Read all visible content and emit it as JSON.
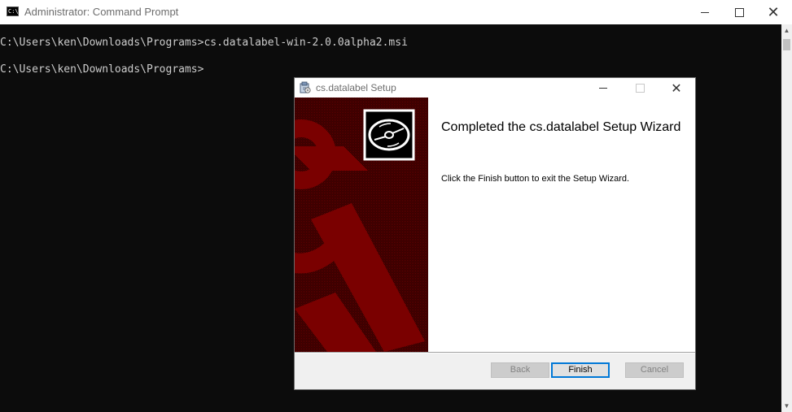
{
  "console_window": {
    "title": "Administrator: Command Prompt",
    "icon": "cmd-icon",
    "icon_text": "C:\\",
    "controls": {
      "minimize": "minimize-icon",
      "maximize": "maximize-icon",
      "close": "close-icon"
    },
    "lines": [
      "C:\\Users\\ken\\Downloads\\Programs>cs.datalabel-win-2.0.0alpha2.msi",
      "C:\\Users\\ken\\Downloads\\Programs>"
    ],
    "background_color": "#0c0c0c",
    "text_color": "#cccccc"
  },
  "setup_dialog": {
    "title": "cs.datalabel Setup",
    "icon": "installer-icon",
    "banner_icon": "disc-icon",
    "banner_color": "#7a0000",
    "heading": "Completed the cs.datalabel Setup Wizard",
    "message": "Click the Finish button to exit the Setup Wizard.",
    "buttons": {
      "back": "Back",
      "finish": "Finish",
      "cancel": "Cancel"
    },
    "accent_color": "#0078d7"
  }
}
